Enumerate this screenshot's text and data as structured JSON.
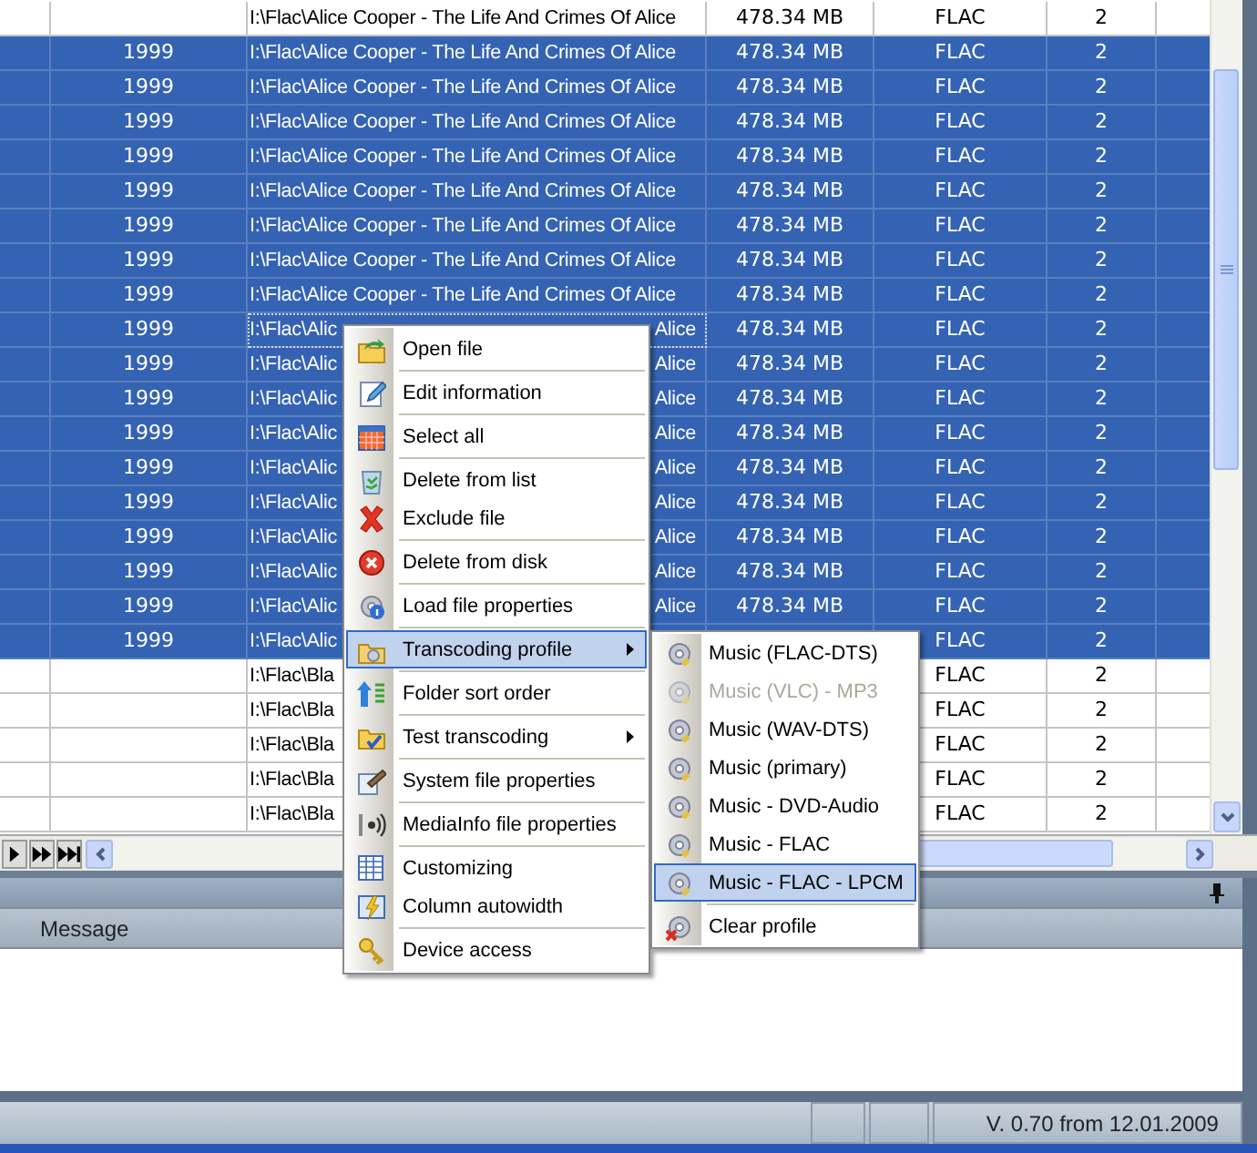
{
  "table": {
    "rows": [
      {
        "selected": false,
        "focused": false,
        "path": "I:\\Flac\\Alice Cooper - The Life And Crimes Of Alice",
        "size": "478.34 MB",
        "format": "FLAC",
        "channels": "2"
      },
      {
        "selected": true,
        "focused": false,
        "year": "1999",
        "path": "I:\\Flac\\Alice Cooper - The Life And Crimes Of Alice",
        "size": "478.34 MB",
        "format": "FLAC",
        "channels": "2"
      },
      {
        "selected": true,
        "focused": false,
        "year": "1999",
        "path": "I:\\Flac\\Alice Cooper - The Life And Crimes Of Alice",
        "size": "478.34 MB",
        "format": "FLAC",
        "channels": "2"
      },
      {
        "selected": true,
        "focused": false,
        "year": "1999",
        "path": "I:\\Flac\\Alice Cooper - The Life And Crimes Of Alice",
        "size": "478.34 MB",
        "format": "FLAC",
        "channels": "2"
      },
      {
        "selected": true,
        "focused": false,
        "year": "1999",
        "path": "I:\\Flac\\Alice Cooper - The Life And Crimes Of Alice",
        "size": "478.34 MB",
        "format": "FLAC",
        "channels": "2"
      },
      {
        "selected": true,
        "focused": false,
        "year": "1999",
        "path": "I:\\Flac\\Alice Cooper - The Life And Crimes Of Alice",
        "size": "478.34 MB",
        "format": "FLAC",
        "channels": "2"
      },
      {
        "selected": true,
        "focused": false,
        "year": "1999",
        "path": "I:\\Flac\\Alice Cooper - The Life And Crimes Of Alice",
        "size": "478.34 MB",
        "format": "FLAC",
        "channels": "2"
      },
      {
        "selected": true,
        "focused": false,
        "year": "1999",
        "path": "I:\\Flac\\Alice Cooper - The Life And Crimes Of Alice",
        "size": "478.34 MB",
        "format": "FLAC",
        "channels": "2"
      },
      {
        "selected": true,
        "focused": false,
        "year": "1999",
        "path": "I:\\Flac\\Alice Cooper - The Life And Crimes Of Alice",
        "size": "478.34 MB",
        "format": "FLAC",
        "channels": "2"
      },
      {
        "selected": true,
        "focused": true,
        "year": "1999",
        "path": "I:\\Flac\\Alic",
        "path_tail": "Alice",
        "size": "478.34 MB",
        "format": "FLAC",
        "channels": "2"
      },
      {
        "selected": true,
        "focused": false,
        "year": "1999",
        "path": "I:\\Flac\\Alic",
        "path_tail": "Alice",
        "size": "478.34 MB",
        "format": "FLAC",
        "channels": "2"
      },
      {
        "selected": true,
        "focused": false,
        "year": "1999",
        "path": "I:\\Flac\\Alic",
        "path_tail": "Alice",
        "size": "478.34 MB",
        "format": "FLAC",
        "channels": "2"
      },
      {
        "selected": true,
        "focused": false,
        "year": "1999",
        "path": "I:\\Flac\\Alic",
        "path_tail": "Alice",
        "size": "478.34 MB",
        "format": "FLAC",
        "channels": "2"
      },
      {
        "selected": true,
        "focused": false,
        "year": "1999",
        "path": "I:\\Flac\\Alic",
        "path_tail": "Alice",
        "size": "478.34 MB",
        "format": "FLAC",
        "channels": "2"
      },
      {
        "selected": true,
        "focused": false,
        "year": "1999",
        "path": "I:\\Flac\\Alic",
        "path_tail": "Alice",
        "size": "478.34 MB",
        "format": "FLAC",
        "channels": "2"
      },
      {
        "selected": true,
        "focused": false,
        "year": "1999",
        "path": "I:\\Flac\\Alic",
        "path_tail": "Alice",
        "size": "478.34 MB",
        "format": "FLAC",
        "channels": "2"
      },
      {
        "selected": true,
        "focused": false,
        "year": "1999",
        "path": "I:\\Flac\\Alic",
        "path_tail": "Alice",
        "size": "478.34 MB",
        "format": "FLAC",
        "channels": "2"
      },
      {
        "selected": true,
        "focused": false,
        "year": "1999",
        "path": "I:\\Flac\\Alic",
        "path_tail": "Alice",
        "size": "478.34 MB",
        "format": "FLAC",
        "channels": "2"
      },
      {
        "selected": true,
        "focused": false,
        "year": "1999",
        "path": "I:\\Flac\\Alic",
        "format": "FLAC",
        "channels": "2"
      },
      {
        "selected": false,
        "focused": false,
        "path": "I:\\Flac\\Bla",
        "format": "FLAC",
        "channels": "2"
      },
      {
        "selected": false,
        "focused": false,
        "path": "I:\\Flac\\Bla",
        "format": "FLAC",
        "channels": "2"
      },
      {
        "selected": false,
        "focused": false,
        "path": "I:\\Flac\\Bla",
        "format": "FLAC",
        "channels": "2"
      },
      {
        "selected": false,
        "focused": false,
        "path": "I:\\Flac\\Bla",
        "format": "FLAC",
        "channels": "2"
      },
      {
        "selected": false,
        "focused": false,
        "path": "I:\\Flac\\Bla",
        "format": "FLAC",
        "channels": "2"
      }
    ]
  },
  "context_menu": {
    "items": [
      {
        "kind": "item",
        "label": "Open file",
        "selected": false,
        "submenu": false
      },
      {
        "kind": "separator"
      },
      {
        "kind": "item",
        "label": "Edit information",
        "selected": false,
        "submenu": false
      },
      {
        "kind": "separator"
      },
      {
        "kind": "item",
        "label": "Select all",
        "selected": false,
        "submenu": false
      },
      {
        "kind": "separator"
      },
      {
        "kind": "item",
        "label": "Delete from list",
        "selected": false,
        "submenu": false
      },
      {
        "kind": "item",
        "label": "Exclude file",
        "selected": false,
        "submenu": false
      },
      {
        "kind": "separator"
      },
      {
        "kind": "item",
        "label": "Delete from disk",
        "selected": false,
        "submenu": false
      },
      {
        "kind": "separator"
      },
      {
        "kind": "item",
        "label": "Load file properties",
        "selected": false,
        "submenu": false
      },
      {
        "kind": "separator"
      },
      {
        "kind": "item",
        "label": "Transcoding profile",
        "selected": true,
        "submenu": true
      },
      {
        "kind": "separator"
      },
      {
        "kind": "item",
        "label": "Folder sort order",
        "selected": false,
        "submenu": false
      },
      {
        "kind": "separator"
      },
      {
        "kind": "item",
        "label": "Test transcoding",
        "selected": false,
        "submenu": true
      },
      {
        "kind": "separator"
      },
      {
        "kind": "item",
        "label": "System file properties",
        "selected": false,
        "submenu": false
      },
      {
        "kind": "separator"
      },
      {
        "kind": "item",
        "label": "MediaInfo file properties",
        "selected": false,
        "submenu": false
      },
      {
        "kind": "separator"
      },
      {
        "kind": "item",
        "label": "Customizing",
        "selected": false,
        "submenu": false
      },
      {
        "kind": "item",
        "label": "Column autowidth",
        "selected": false,
        "submenu": false
      },
      {
        "kind": "separator"
      },
      {
        "kind": "item",
        "label": "Device access",
        "selected": false,
        "submenu": false
      }
    ]
  },
  "submenu": {
    "items": [
      {
        "kind": "item",
        "label": "Music (FLAC-DTS)",
        "selected": false,
        "disabled": false
      },
      {
        "kind": "item",
        "label": "Music (VLC) - MP3",
        "selected": false,
        "disabled": true
      },
      {
        "kind": "item",
        "label": "Music (WAV-DTS)",
        "selected": false,
        "disabled": false
      },
      {
        "kind": "item",
        "label": "Music (primary)",
        "selected": false,
        "disabled": false
      },
      {
        "kind": "item",
        "label": "Music - DVD-Audio",
        "selected": false,
        "disabled": false
      },
      {
        "kind": "item",
        "label": "Music - FLAC",
        "selected": false,
        "disabled": false
      },
      {
        "kind": "item",
        "label": "Music - FLAC - LPCM",
        "selected": true,
        "disabled": false
      },
      {
        "kind": "separator"
      },
      {
        "kind": "item",
        "label": "Clear profile",
        "selected": false,
        "disabled": false
      }
    ]
  },
  "log_panel": {
    "columns": [
      "Message"
    ]
  },
  "status_bar": {
    "version": "V. 0.70 from 12.01.2009"
  }
}
